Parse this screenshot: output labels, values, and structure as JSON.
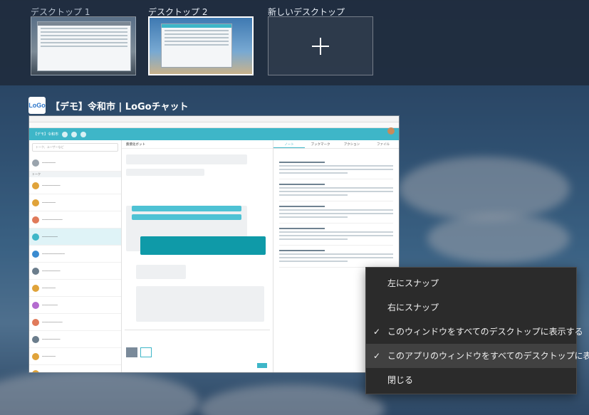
{
  "desktops": [
    {
      "label": "デスクトップ 1",
      "active": false
    },
    {
      "label": "デスクトップ 2",
      "active": true
    },
    {
      "label": "新しいデスクトップ",
      "is_new": true
    }
  ],
  "new_desktop_icon": "plus-icon",
  "app_window": {
    "logo_text": "LoGo",
    "title": "【デモ】令和市 | LoGoチャット",
    "header_workspace": "【デモ】令和市",
    "search_placeholder": "トーク、ユーザーなど",
    "section_label": "トーク",
    "chat_title": "無償化ボット",
    "right_tabs": [
      "ノート",
      "ブックマーク",
      "アクション",
      "ファイル"
    ],
    "accent_color": "#3eb6c8"
  },
  "context_menu": {
    "items": [
      {
        "label": "左にスナップ",
        "checked": false,
        "hover": false
      },
      {
        "label": "右にスナップ",
        "checked": false,
        "hover": false
      },
      {
        "label": "このウィンドウをすべてのデスクトップに表示する",
        "checked": true,
        "hover": false
      },
      {
        "label": "このアプリのウィンドウをすべてのデスクトップに表示する",
        "checked": true,
        "hover": true
      },
      {
        "label": "閉じる",
        "checked": false,
        "hover": false
      }
    ],
    "check_glyph": "✓"
  }
}
